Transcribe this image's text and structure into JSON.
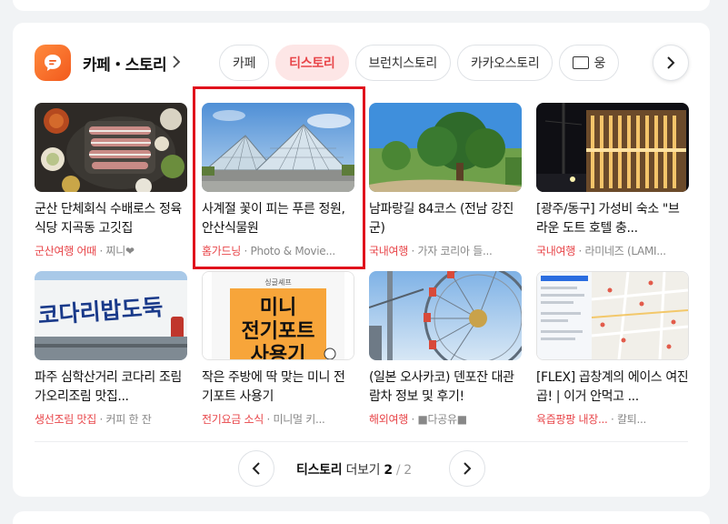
{
  "section": {
    "title": "카페・스토리",
    "accent_color": "#f25a1d"
  },
  "tabs": [
    {
      "label": "카페",
      "active": false
    },
    {
      "label": "티스토리",
      "active": true
    },
    {
      "label": "브런치스토리",
      "active": false
    },
    {
      "label": "카카오스토리",
      "active": false
    },
    {
      "label": "웅",
      "active": false
    }
  ],
  "items": [
    {
      "title": "군산 단체회식 수배로스 정육식당 지곡동 고깃집",
      "tag": "군산여행 어때",
      "source": "찌니❤"
    },
    {
      "title": "사계절 꽃이 피는 푸른 정원, 안산식물원",
      "tag": "홈가드닝",
      "source": "Photo & Movie..."
    },
    {
      "title": "남파랑길 84코스 (전남 강진군)",
      "tag": "국내여행",
      "source": "가자 코리아 들..."
    },
    {
      "title": "[광주/동구] 가성비 숙소 \"브라운 도트 호텔 충...",
      "tag": "국내여행",
      "source": "라미네즈 (LAMI..."
    },
    {
      "title": "파주 심학산거리 코다리 조림 가오리조림 맛집...",
      "tag": "생선조림 맛집",
      "source": "커피 한 잔"
    },
    {
      "title": "작은 주방에 딱 맞는 미니 전기포트 사용기",
      "tag": "전기요금 소식",
      "source": "미니멀 키..."
    },
    {
      "title": "(일본 오사카코) 덴포잔 대관람차 정보 및 후기!",
      "tag": "해외여행",
      "source": "■다공유■"
    },
    {
      "title": "[FLEX] 곱창계의 에이스 여진곱! | 이거 안먹고 ...",
      "tag": "육즙팡팡 내장...",
      "source": "칼퇴..."
    }
  ],
  "thumb_text": {
    "sign": "코다리밥도둑",
    "poster_top": "싱글셰프",
    "poster_line1": "미니",
    "poster_line2": "전기포트",
    "poster_line3": "사용기"
  },
  "pager": {
    "label": "티스토리",
    "more": "더보기",
    "current": "2",
    "slash": "/",
    "total": "2"
  }
}
